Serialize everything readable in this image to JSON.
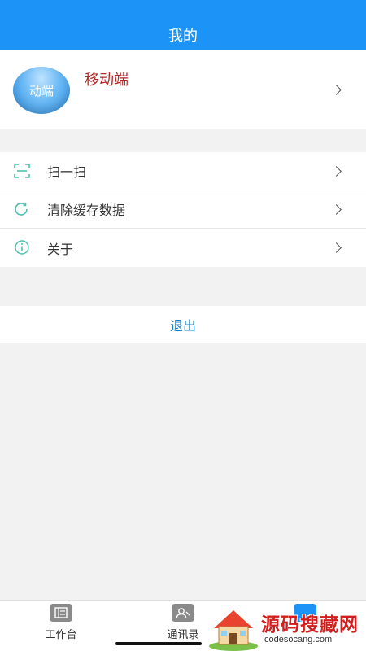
{
  "header": {
    "title": "我的"
  },
  "profile": {
    "avatar_text": "动端",
    "name": "移动端"
  },
  "menu": {
    "items": [
      {
        "label": "扫一扫",
        "icon": "scan-icon"
      },
      {
        "label": "清除缓存数据",
        "icon": "refresh-icon"
      },
      {
        "label": "关于",
        "icon": "info-icon"
      }
    ]
  },
  "logout": {
    "label": "退出"
  },
  "tabbar": {
    "tabs": [
      {
        "label": "工作台",
        "icon": "workbench-icon"
      },
      {
        "label": "通讯录",
        "icon": "contacts-icon"
      },
      {
        "label": "",
        "icon": "profile-icon"
      }
    ]
  },
  "watermark": {
    "text": "源码搜藏网",
    "subtext": "codesocang.com"
  },
  "colors": {
    "primary": "#1c93f7",
    "name_red": "#b0282a",
    "icon_teal": "#4fbfb0",
    "logout_blue": "#1b7fc7"
  }
}
